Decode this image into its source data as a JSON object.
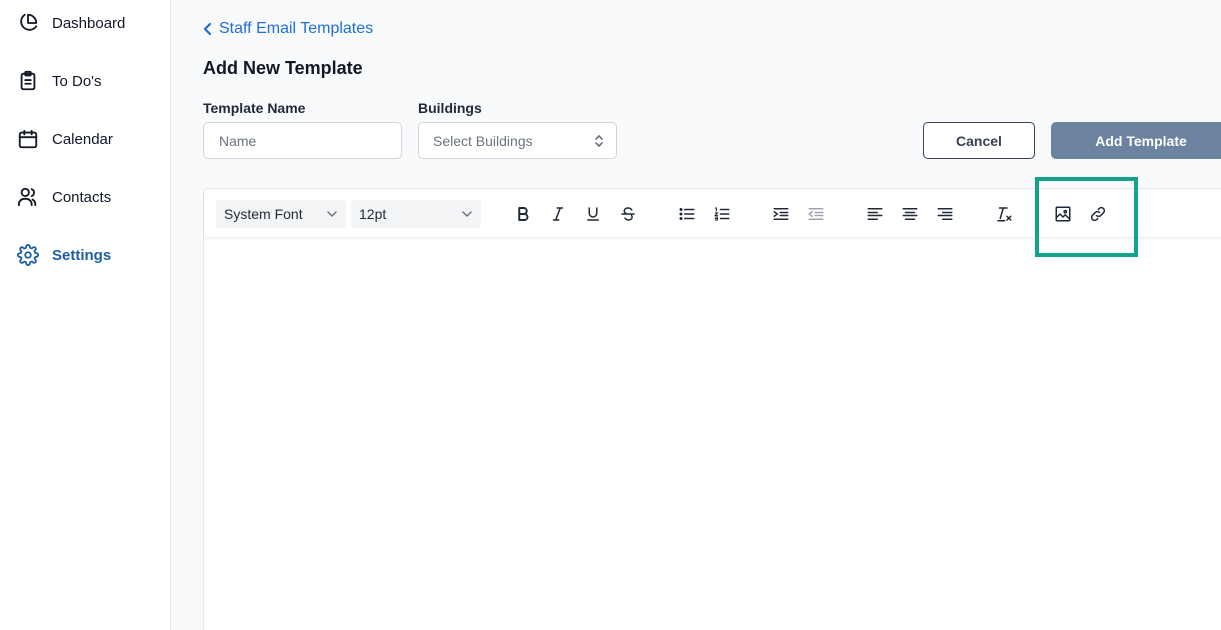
{
  "sidebar": {
    "items": [
      {
        "label": "Dashboard",
        "icon": "pie-chart-icon"
      },
      {
        "label": "To Do's",
        "icon": "clipboard-icon"
      },
      {
        "label": "Calendar",
        "icon": "calendar-icon"
      },
      {
        "label": "Contacts",
        "icon": "users-icon"
      },
      {
        "label": "Settings",
        "icon": "gear-icon",
        "active": true
      }
    ]
  },
  "header": {
    "back_label": "Staff Email Templates",
    "title": "Add New Template"
  },
  "form": {
    "template_name_label": "Template Name",
    "template_name_placeholder": "Name",
    "template_name_value": "",
    "buildings_label": "Buildings",
    "buildings_placeholder": "Select Buildings",
    "cancel_label": "Cancel",
    "add_label": "Add Template"
  },
  "editor": {
    "font_family": "System Font",
    "font_size": "12pt",
    "tools": [
      "bold",
      "italic",
      "underline",
      "strikethrough",
      "bullet-list",
      "numbered-list",
      "indent",
      "outdent",
      "align-left",
      "align-center",
      "align-right",
      "clear-formatting",
      "insert-image",
      "insert-link"
    ]
  },
  "colors": {
    "accent": "#1d6fd6",
    "active_nav": "#1d5fa8",
    "primary_button": "#6b82a0",
    "highlight": "#12a38b"
  }
}
